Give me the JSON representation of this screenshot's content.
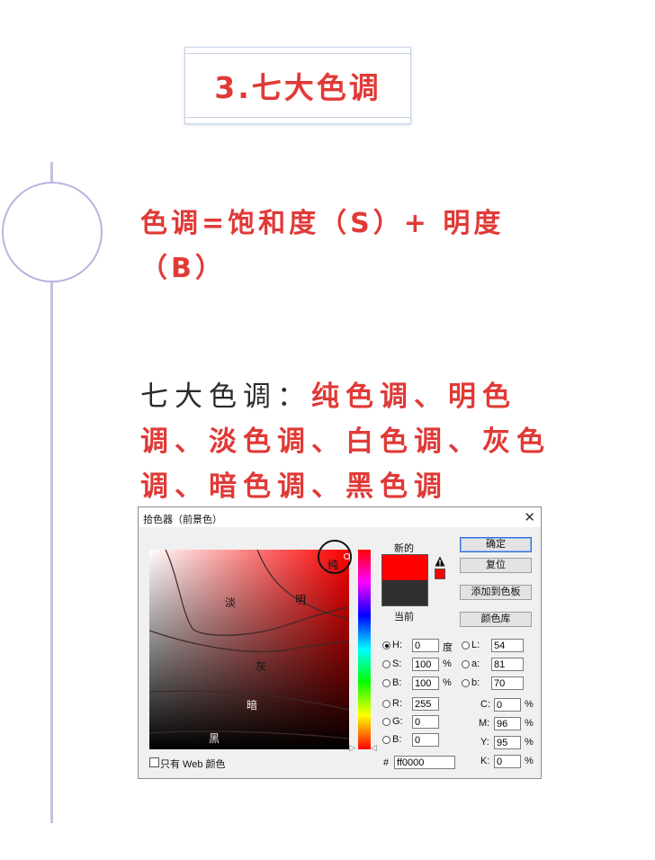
{
  "title": "3.七大色调",
  "formula": "色调=饱和度（S）+ 明度（B）",
  "tones": {
    "lead": "七大色调：",
    "list": "纯色调、明色调、淡色调、白色调、灰色调、暗色调、黑色调"
  },
  "dialog": {
    "title": "拾色器（前景色）",
    "close": "✕",
    "field_labels": {
      "pure": "纯",
      "light": "明",
      "pale": "淡",
      "gray": "灰",
      "dark": "暗",
      "black": "黑"
    },
    "new_label": "新的",
    "current_label": "当前",
    "buttons": {
      "ok": "确定",
      "reset": "复位",
      "add_swatch": "添加到色板",
      "libraries": "颜色库"
    },
    "hsb": {
      "h": {
        "label": "H:",
        "value": "0",
        "unit": "度"
      },
      "s": {
        "label": "S:",
        "value": "100",
        "unit": "%"
      },
      "b": {
        "label": "B:",
        "value": "100",
        "unit": "%"
      }
    },
    "rgb": {
      "r": {
        "label": "R:",
        "value": "255"
      },
      "g": {
        "label": "G:",
        "value": "0"
      },
      "b": {
        "label": "B:",
        "value": "0"
      }
    },
    "lab": {
      "l": {
        "label": "L:",
        "value": "54"
      },
      "a": {
        "label": "a:",
        "value": "81"
      },
      "b": {
        "label": "b:",
        "value": "70"
      }
    },
    "cmyk": {
      "c": {
        "label": "C:",
        "value": "0",
        "unit": "%"
      },
      "m": {
        "label": "M:",
        "value": "96",
        "unit": "%"
      },
      "y": {
        "label": "Y:",
        "value": "95",
        "unit": "%"
      },
      "k": {
        "label": "K:",
        "value": "0",
        "unit": "%"
      }
    },
    "hex_label": "#",
    "hex_value": "ff0000",
    "web_only": "只有 Web 颜色"
  },
  "colors": {
    "accent": "#e03a37",
    "timeline": "#c3c0e3",
    "selected": "#ff0000"
  }
}
